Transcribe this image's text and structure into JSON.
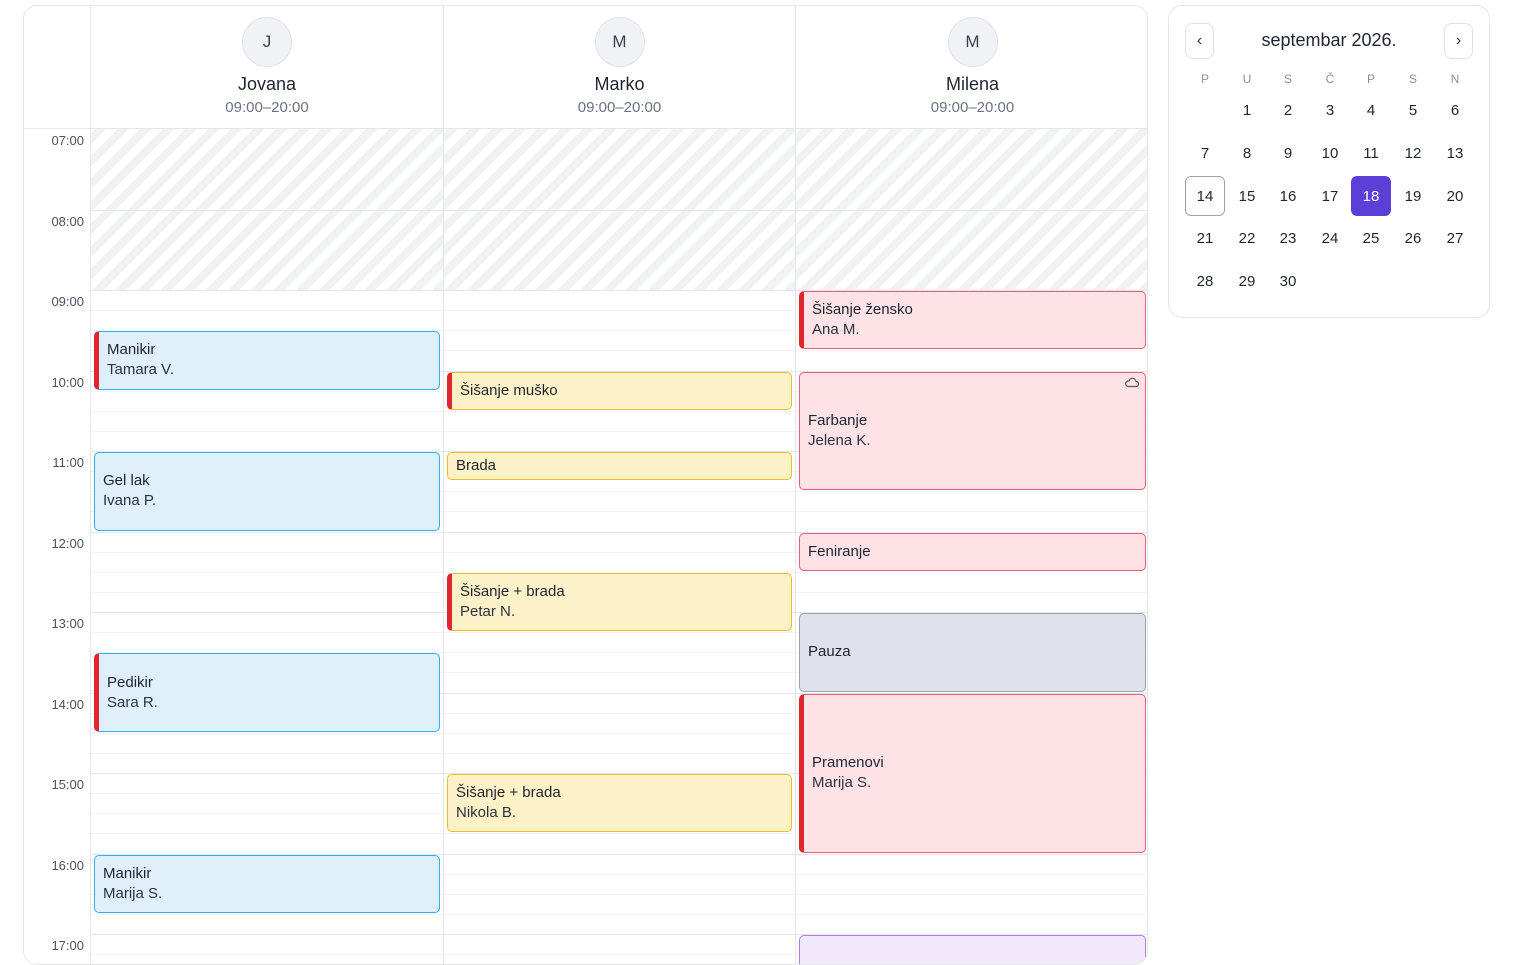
{
  "staff": [
    {
      "initial": "J",
      "name": "Jovana",
      "hours": "09:00–20:00"
    },
    {
      "initial": "M",
      "name": "Marko",
      "hours": "09:00–20:00"
    },
    {
      "initial": "M",
      "name": "Milena",
      "hours": "09:00–20:00"
    }
  ],
  "times": [
    "07:00",
    "08:00",
    "09:00",
    "10:00",
    "11:00",
    "12:00",
    "13:00",
    "14:00",
    "15:00",
    "16:00",
    "17:00"
  ],
  "appointments": [
    {
      "staff": 0,
      "start": "09:30",
      "end": "10:15",
      "title": "Manikir",
      "client": "Tamara V.",
      "color": "blue",
      "bar": true
    },
    {
      "staff": 0,
      "start": "11:00",
      "end": "12:00",
      "title": "Gel lak",
      "client": "Ivana P.",
      "color": "blue",
      "bar": false
    },
    {
      "staff": 0,
      "start": "13:30",
      "end": "14:30",
      "title": "Pedikir",
      "client": "Sara R.",
      "color": "blue",
      "bar": true
    },
    {
      "staff": 0,
      "start": "16:00",
      "end": "16:45",
      "title": "Manikir",
      "client": "Marija S.",
      "color": "blue",
      "bar": false
    },
    {
      "staff": 1,
      "start": "10:00",
      "end": "10:30",
      "title": "Šišanje muško",
      "client": "",
      "color": "yellow",
      "bar": true
    },
    {
      "staff": 1,
      "start": "11:00",
      "end": "11:22",
      "title": "Brada",
      "client": "",
      "color": "yellow",
      "bar": false
    },
    {
      "staff": 1,
      "start": "12:30",
      "end": "13:15",
      "title": "Šišanje + brada",
      "client": "Petar N.",
      "color": "yellow",
      "bar": true
    },
    {
      "staff": 1,
      "start": "15:00",
      "end": "15:45",
      "title": "Šišanje + brada",
      "client": "Nikola B.",
      "color": "yellow",
      "bar": false
    },
    {
      "staff": 2,
      "start": "09:00",
      "end": "09:45",
      "title": "Šišanje žensko",
      "client": "Ana M.",
      "color": "pink",
      "bar": true
    },
    {
      "staff": 2,
      "start": "10:00",
      "end": "11:30",
      "title": "Farbanje",
      "client": "Jelena K.",
      "color": "pink",
      "bar": false,
      "icon": "cloud-icon"
    },
    {
      "staff": 2,
      "start": "12:00",
      "end": "12:30",
      "title": "Feniranje",
      "client": "",
      "color": "pink",
      "bar": false
    },
    {
      "staff": 2,
      "start": "13:00",
      "end": "14:00",
      "title": "Pauza",
      "client": "",
      "color": "gray",
      "bar": false
    },
    {
      "staff": 2,
      "start": "14:00",
      "end": "16:00",
      "title": "Pramenovi",
      "client": "Marija S.",
      "color": "pink",
      "bar": true
    },
    {
      "staff": 2,
      "start": "17:00",
      "end": "17:45",
      "title": "",
      "client": "",
      "color": "purple",
      "bar": false
    }
  ],
  "calendar": {
    "title": "septembar 2026.",
    "prev_label": "‹",
    "next_label": "›",
    "weekdays": [
      "P",
      "U",
      "S",
      "Č",
      "P",
      "S",
      "N"
    ],
    "first_weekday_index": 1,
    "days_in_month": 30,
    "today": 14,
    "selected": 18
  },
  "colors": {
    "accent": "#5b3fd6",
    "bar": "#e0262e"
  }
}
